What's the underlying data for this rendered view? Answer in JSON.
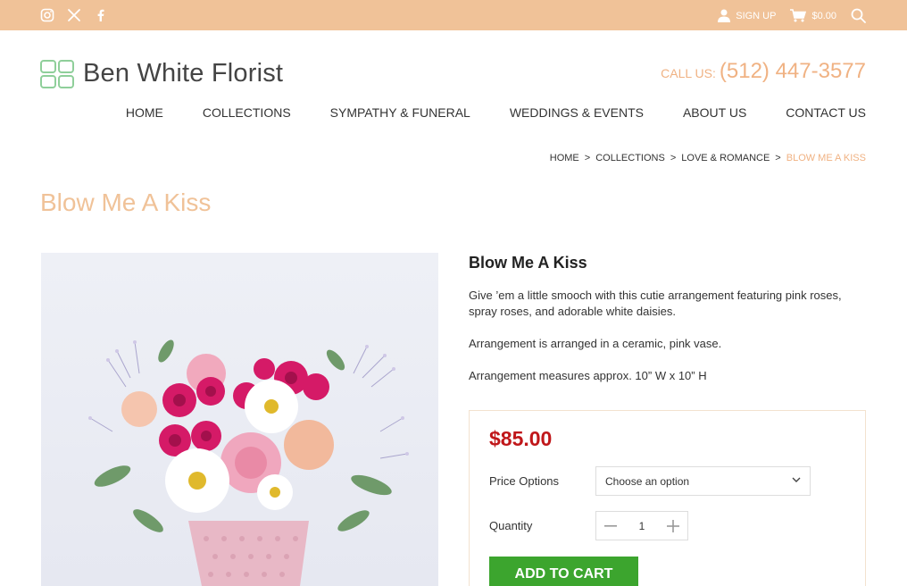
{
  "topbar": {
    "social": [
      "instagram-icon",
      "x-icon",
      "facebook-icon"
    ],
    "signup_label": "SIGN UP",
    "cart_total": "$0.00"
  },
  "brand": {
    "name": "Ben White Florist",
    "logo_color": "#8fcf9a"
  },
  "contact": {
    "label": "CALL US:",
    "phone": "(512) 447-3577"
  },
  "nav": [
    "HOME",
    "COLLECTIONS",
    "SYMPATHY & FUNERAL",
    "WEDDINGS & EVENTS",
    "ABOUT US",
    "CONTACT US"
  ],
  "breadcrumb": [
    "HOME",
    "COLLECTIONS",
    "LOVE & ROMANCE",
    "BLOW ME A KISS"
  ],
  "page_title": "Blow Me A Kiss",
  "product": {
    "name": "Blow Me A Kiss",
    "description": [
      "Give ’em a little smooch with this cutie arrangement featuring pink roses, spray roses, and adorable white daisies.",
      "Arrangement is arranged in a ceramic, pink vase.",
      "Arrangement measures approx. 10” W x 10” H"
    ],
    "price": "$85.00",
    "price_options_label": "Price Options",
    "price_options_placeholder": "Choose an option",
    "quantity_label": "Quantity",
    "quantity": "1",
    "add_to_cart": "ADD TO CART"
  },
  "colors": {
    "accent": "#f0c298",
    "price": "#c0171a",
    "button": "#3ca52e"
  }
}
